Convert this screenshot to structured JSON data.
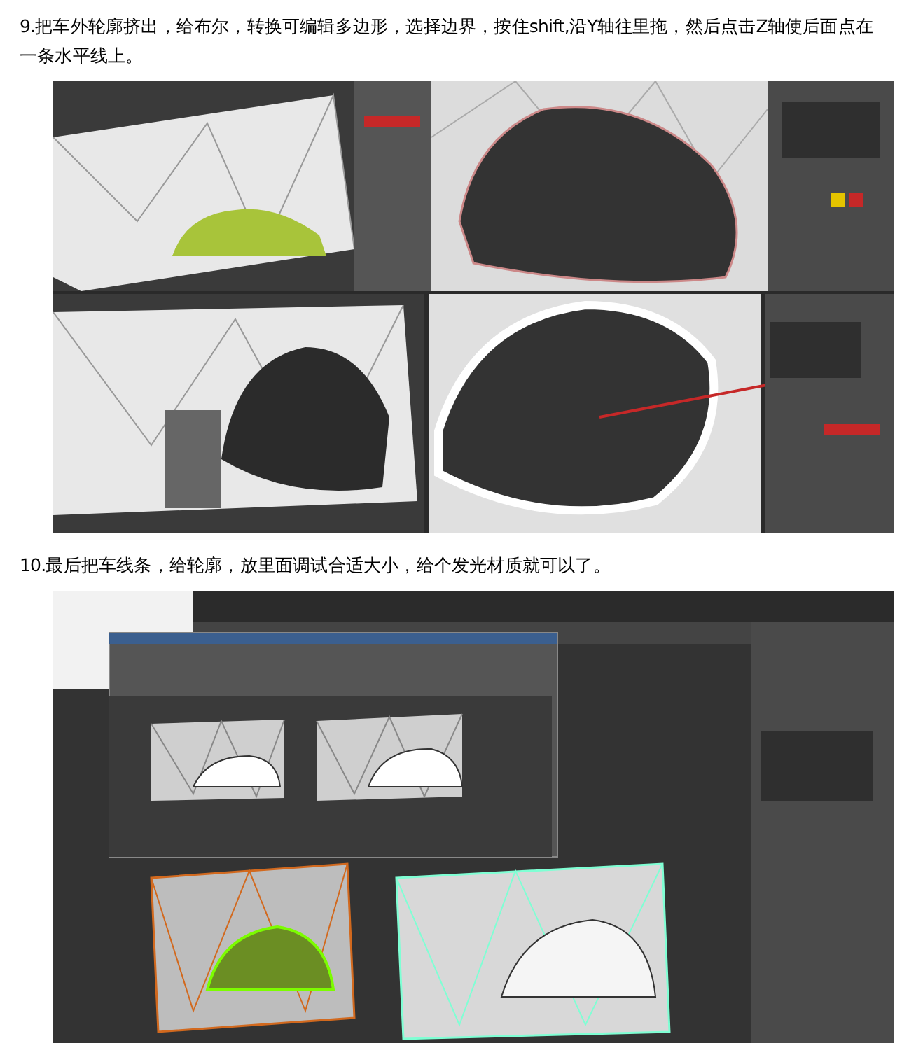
{
  "steps": [
    {
      "text": "9.把车外轮廓挤出，给布尔，转换可编辑多边形，选择边界，按住shift,沿Y轴往里拖，然后点击Z轴使后面点在一条水平线上。",
      "kind": "viewports"
    },
    {
      "text": "10.最后把车线条，给轮廓，放里面调试合适大小，给个发光材质就可以了。",
      "kind": "render"
    }
  ]
}
